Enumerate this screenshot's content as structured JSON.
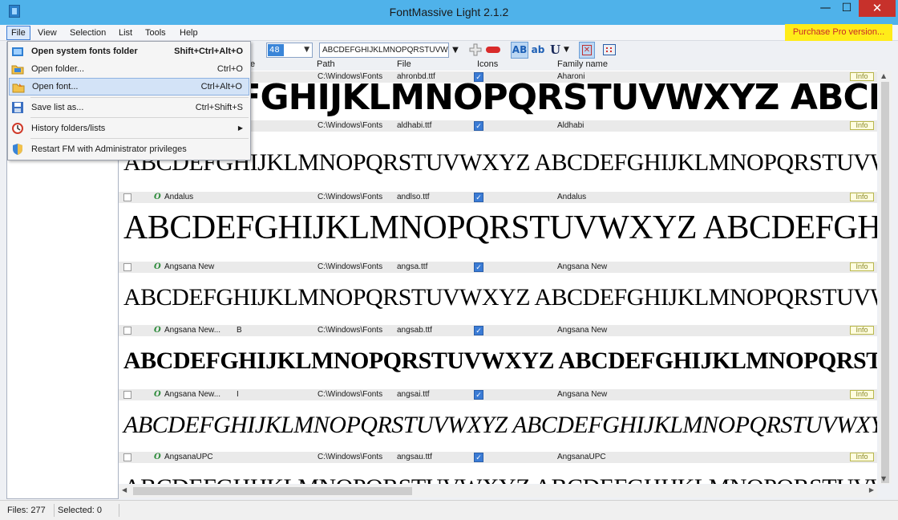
{
  "window": {
    "title": "FontMassive Light 2.1.2",
    "minimize": "—",
    "maximize": "☐",
    "close": "✕"
  },
  "menubar": {
    "items": [
      "File",
      "View",
      "Selection",
      "List",
      "Tools",
      "Help"
    ],
    "purchase_label": "Purchase Pro version..."
  },
  "file_menu": {
    "items": [
      {
        "label": "Open system fonts folder",
        "shortcut": "Shift+Ctrl+Alt+O",
        "icon": "system-folder-icon"
      },
      {
        "label": "Open folder...",
        "shortcut": "Ctrl+O",
        "icon": "folder-icon"
      },
      {
        "label": "Open font...",
        "shortcut": "Ctrl+Alt+O",
        "icon": "open-font-icon"
      },
      {
        "label": "Save list as...",
        "shortcut": "Ctrl+Shift+S",
        "icon": "save-icon"
      },
      {
        "label": "History folders/lists",
        "shortcut": "▶",
        "icon": "history-icon"
      },
      {
        "label": "Restart FM with Administrator privileges",
        "shortcut": "",
        "icon": "shield-icon"
      }
    ]
  },
  "toolbar": {
    "size_value": "48",
    "sample_text": "ABCDEFGHIJKLMNOPQRSTUVW",
    "bold_toggle": "AB",
    "lowercase_toggle": "ab",
    "underline_toggle": "U"
  },
  "list_header": {
    "partial_col": "e",
    "path": "Path",
    "file": "File",
    "icons": "Icons",
    "family": "Family name"
  },
  "fonts": [
    {
      "name": "",
      "style": "",
      "path": "C:\\Windows\\Fonts",
      "file": "ahronbd.ttf",
      "family": "Aharoni",
      "info": "Info",
      "preview": "ABCDEFGHIJKLMNOPQRSTUVWXYZ ABCDEFGHIJKLMNOPQRSTUVWXYZ"
    },
    {
      "name": "",
      "style": "",
      "path": "C:\\Windows\\Fonts",
      "file": "aldhabi.ttf",
      "family": "Aldhabi",
      "info": "Info",
      "preview": "ABCDEFGHIJKLMNOPQRSTUVWXYZ ABCDEFGHIJKLMNOPQRSTUVWXYZ"
    },
    {
      "name": "Andalus",
      "style": "",
      "path": "C:\\Windows\\Fonts",
      "file": "andlso.ttf",
      "family": "Andalus",
      "info": "Info",
      "preview": "ABCDEFGHIJKLMNOPQRSTUVWXYZ ABCDEFGHIJKLMNOPQRSTUVWXYZ"
    },
    {
      "name": "Angsana New",
      "style": "",
      "path": "C:\\Windows\\Fonts",
      "file": "angsa.ttf",
      "family": "Angsana New",
      "info": "Info",
      "preview": "ABCDEFGHIJKLMNOPQRSTUVWXYZ ABCDEFGHIJKLMNOPQRSTUVWXYZ"
    },
    {
      "name": "Angsana New...",
      "style": "B",
      "path": "C:\\Windows\\Fonts",
      "file": "angsab.ttf",
      "family": "Angsana New",
      "info": "Info",
      "preview": "ABCDEFGHIJKLMNOPQRSTUVWXYZ ABCDEFGHIJKLMNOPQRSTUVWXYZ"
    },
    {
      "name": "Angsana New...",
      "style": "I",
      "path": "C:\\Windows\\Fonts",
      "file": "angsai.ttf",
      "family": "Angsana New",
      "info": "Info",
      "preview": "ABCDEFGHIJKLMNOPQRSTUVWXYZ ABCDEFGHIJKLMNOPQRSTUVWXYZ"
    },
    {
      "name": "AngsanaUPC",
      "style": "",
      "path": "C:\\Windows\\Fonts",
      "file": "angsau.ttf",
      "family": "AngsanaUPC",
      "info": "Info",
      "preview": "ABCDEFGHIJKLMNOPQRSTUVWXYZ ABCDEFGHIJKLMNOPQRSTUVWXYZ"
    }
  ],
  "status": {
    "files": "Files: 277",
    "selected": "Selected: 0"
  },
  "colors": {
    "titlebar": "#4fb2ea",
    "close_button": "#c7312b",
    "purchase_bg": "#ffec19",
    "purchase_fg": "#c8282a",
    "checkbox_checked": "#3a7bd5",
    "truetype_icon": "#2c8a3a"
  }
}
